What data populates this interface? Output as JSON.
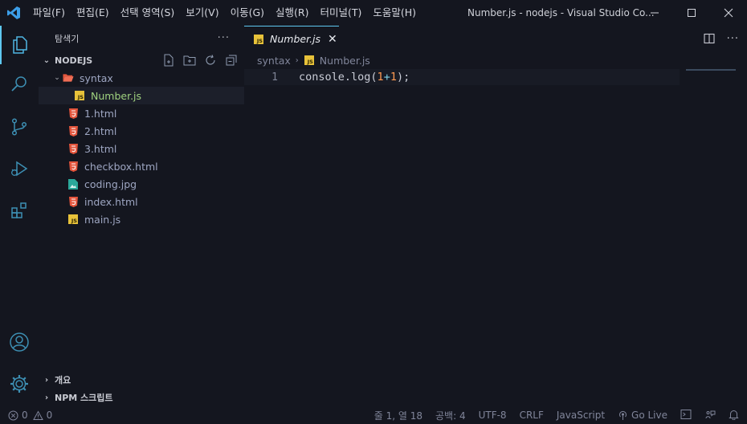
{
  "titlebar": {
    "menu": [
      "파일(F)",
      "편집(E)",
      "선택 영역(S)",
      "보기(V)",
      "이동(G)",
      "실행(R)",
      "터미널(T)",
      "도움말(H)"
    ],
    "window_title": "Number.js - nodejs - Visual Studio Co..."
  },
  "sidebar": {
    "title": "탐색기",
    "more": "···",
    "project": "NODEJS",
    "folder": "syntax",
    "files": {
      "number_js": "Number.js",
      "html1": "1.html",
      "html2": "2.html",
      "html3": "3.html",
      "checkbox": "checkbox.html",
      "coding": "coding.jpg",
      "index": "index.html",
      "main": "main.js"
    },
    "outline": "개요",
    "npm": "NPM 스크립트"
  },
  "editor": {
    "tab_label": "Number.js",
    "breadcrumb": [
      "syntax",
      "Number.js"
    ],
    "line_number": "1",
    "code": {
      "prefix": "console.log(",
      "num1": "1",
      "op": "+",
      "num2": "1",
      "suffix": ");"
    }
  },
  "statusbar": {
    "errors": "0",
    "warnings": "0",
    "position": "줄 1, 열 18",
    "spaces": "공백: 4",
    "encoding": "UTF-8",
    "eol": "CRLF",
    "language": "JavaScript",
    "golive": "Go Live"
  },
  "colors": {
    "accent": "#5ec8f0",
    "selected_file": "#9fd27f",
    "js_icon": "#e8c23a",
    "html_icon": "#e4553c",
    "background": "#14161f"
  }
}
